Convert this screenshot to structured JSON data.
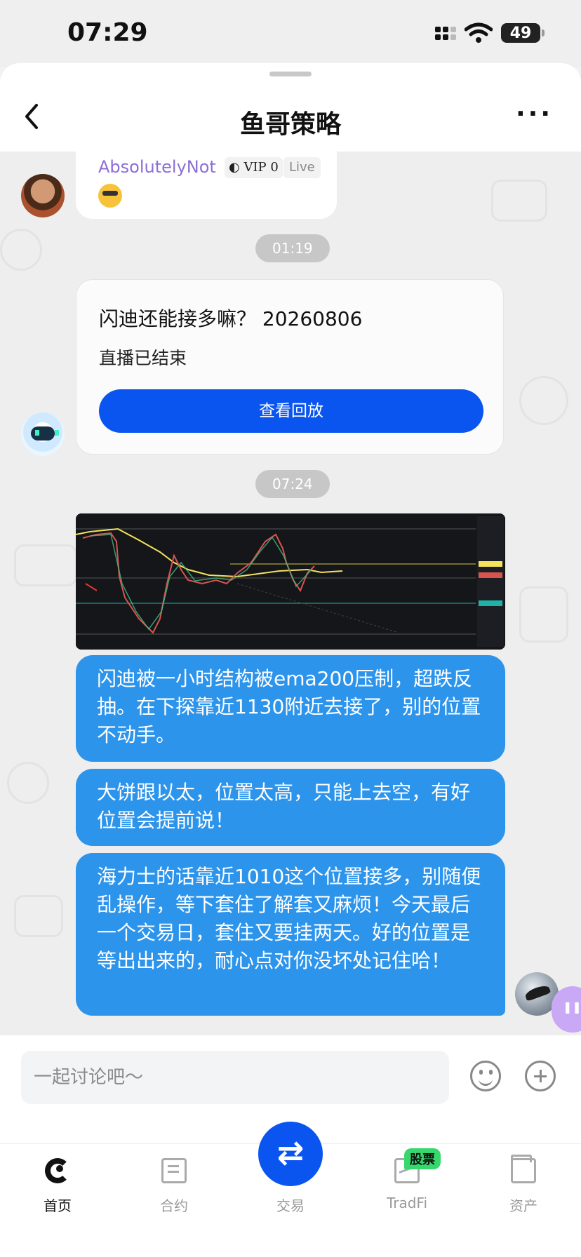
{
  "status_bar": {
    "time": "07:29",
    "battery": "49"
  },
  "header": {
    "title": "鱼哥策略",
    "back_icon": "chevron-left-icon",
    "more_label": "···"
  },
  "messages": {
    "user_name": "AbsolutelyNot",
    "vip_label": "VIP 0",
    "live_label": "Live",
    "timestamp_1": "01:19",
    "live_card": {
      "title": "闪迪还能接多嘛？ 20260806",
      "status": "直播已结束",
      "button": "查看回放"
    },
    "timestamp_2": "07:24",
    "text_1": "闪迪被一小时结构被ema200压制，超跌反抽。在下探靠近1130附近去接了，别的位置不动手。",
    "text_2": "大饼跟以太，位置太高，只能上去空，有好位置会提前说！",
    "text_3": "海力士的话靠近1010这个位置接多，别随便乱操作，等下套住了解套又麻烦！今天最后一个交易日，套住又要挂两天。好的位置是等出出来的，耐心点对你没坏处记住哈！"
  },
  "input": {
    "placeholder": "一起讨论吧～"
  },
  "tabs": [
    {
      "label": "首页",
      "icon": "home-icon"
    },
    {
      "label": "合约",
      "icon": "contract-icon"
    },
    {
      "label": "交易",
      "icon": "swap-icon"
    },
    {
      "label": "TradFi",
      "icon": "tradfi-icon",
      "badge": "股票"
    },
    {
      "label": "资产",
      "icon": "wallet-icon"
    }
  ],
  "colors": {
    "primary_blue": "#0a55f0",
    "bubble_blue": "#2d94ec",
    "username_purple": "#8c6fd6",
    "badge_green": "#36d86e"
  }
}
